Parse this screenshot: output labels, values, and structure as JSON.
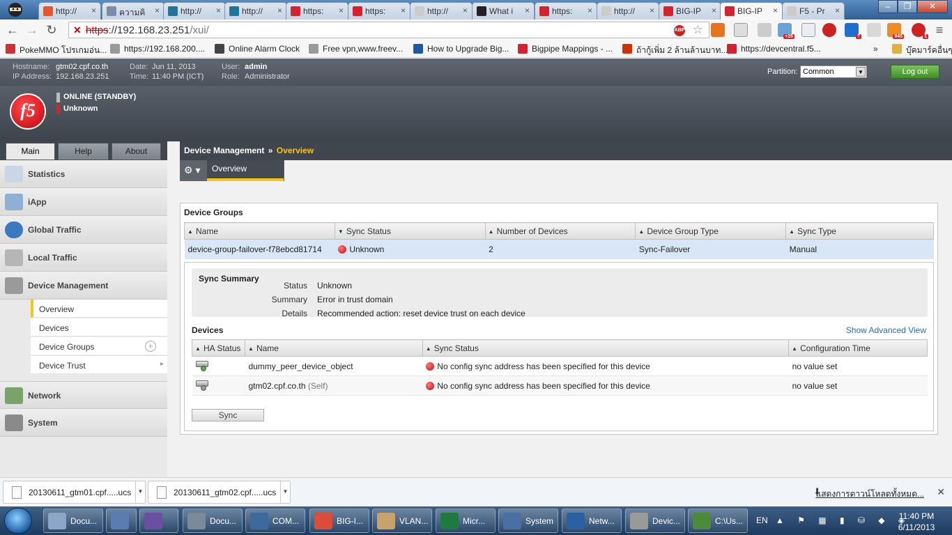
{
  "browser": {
    "tabs": [
      {
        "label": "http://",
        "color": "#e4572e"
      },
      {
        "label": "ความคิ",
        "color": "#7a8ca8"
      },
      {
        "label": "http://",
        "color": "#21759b"
      },
      {
        "label": "http://",
        "color": "#21759b"
      },
      {
        "label": "https:",
        "color": "#d3232e"
      },
      {
        "label": "https:",
        "color": "#d3232e"
      },
      {
        "label": "http://",
        "color": "#cccccc"
      },
      {
        "label": "What i",
        "color": "#222222"
      },
      {
        "label": "https:",
        "color": "#d3232e"
      },
      {
        "label": "http://",
        "color": "#cccccc"
      },
      {
        "label": "BIG-IP",
        "color": "#d3232e"
      },
      {
        "label": "BIG-IP",
        "color": "#d3232e"
      },
      {
        "label": "F5 - Pr",
        "color": "#cccccc"
      }
    ],
    "active_tab_index": 11,
    "address": {
      "scheme": "https",
      "host": "://192.168.23.251",
      "path": "/xui/"
    },
    "bookmarks": [
      {
        "label": "PokeMMO โปรเกมอ่น...",
        "color": "#c33"
      },
      {
        "label": "https://192.168.200....",
        "color": "#999"
      },
      {
        "label": "Online Alarm Clock",
        "color": "#444"
      },
      {
        "label": "Free vpn,www.freev...",
        "color": "#999"
      },
      {
        "label": "How to Upgrade Big...",
        "color": "#1c5aa6"
      },
      {
        "label": "Bigpipe Mappings - ...",
        "color": "#d3232e"
      },
      {
        "label": "ถ้ากู้เพิ่ม 2 ล้านล้านบาท...",
        "color": "#c30"
      },
      {
        "label": "https://devcentral.f5...",
        "color": "#d3232e"
      },
      {
        "label": "»",
        "color": ""
      },
      {
        "label": "บุ๊คมาร์คอื่นๆ",
        "color": "#e0b040"
      }
    ]
  },
  "header": {
    "hostname_key": "Hostname:",
    "hostname": "gtm02.cpf.co.th",
    "ip_key": "IP Address:",
    "ip": "192.168.23.251",
    "date_key": "Date:",
    "date": "Jun 11, 2013",
    "time_key": "Time:",
    "time": "11:40 PM (ICT)",
    "user_key": "User:",
    "user": "admin",
    "role_key": "Role:",
    "role": "Administrator",
    "partition_label": "Partition:",
    "partition_value": "Common",
    "logout_label": "Log out",
    "logo_text": "f5",
    "status_online": "ONLINE (STANDBY)",
    "status_sync": "Unknown",
    "status_online_color": "#bbbbbb",
    "status_sync_color": "#e02020"
  },
  "nav": {
    "tabs": [
      "Main",
      "Help",
      "About"
    ],
    "items": [
      {
        "label": "Statistics",
        "color": "#c8d6e5"
      },
      {
        "label": "iApp",
        "color": "#8fb0d3"
      },
      {
        "label": "Global Traffic",
        "color": "#3a78c2"
      },
      {
        "label": "Local Traffic",
        "color": "#b6b6b6"
      },
      {
        "label": "Device Management",
        "color": "#9a9a9a"
      },
      {
        "label": "Network",
        "color": "#7aa36a"
      },
      {
        "label": "System",
        "color": "#8a8a8a"
      }
    ],
    "sub_items": [
      "Overview",
      "Devices",
      "Device Groups",
      "Device Trust"
    ]
  },
  "main": {
    "breadcrumb_section": "Device Management",
    "breadcrumb_sep": "»",
    "breadcrumb_current": "Overview",
    "tab_label": "Overview",
    "device_groups_title": "Device Groups",
    "dg_columns": [
      "Name",
      "Sync Status",
      "Number of Devices",
      "Device Group Type",
      "Sync Type"
    ],
    "dg_rows": [
      {
        "name": "device-group-failover-f78ebcd81714",
        "sync_status": "Unknown",
        "count": "2",
        "type": "Sync-Failover",
        "sync_type": "Manual"
      }
    ],
    "sync_summary": {
      "title": "Sync Summary",
      "status_key": "Status",
      "status": "Unknown",
      "summary_key": "Summary",
      "summary": "Error in trust domain",
      "details_key": "Details",
      "details": "Recommended action: reset device trust on each device"
    },
    "devices_title": "Devices",
    "advanced_link": "Show Advanced View",
    "dev_columns": [
      "HA Status",
      "Name",
      "Sync Status",
      "Configuration Time"
    ],
    "dev_rows": [
      {
        "name": "dummy_peer_device_object",
        "self": "",
        "sync_status": "No config sync address has been specified for this device",
        "config_time": "no value set",
        "ha_color": "#4fb83b"
      },
      {
        "name": "gtm02.cpf.co.th",
        "self": "(Self)",
        "sync_status": "No config sync address has been specified for this device",
        "config_time": "no value set",
        "ha_color": "#9a9a9a"
      }
    ],
    "sync_button": "Sync"
  },
  "downloads": {
    "items": [
      "20130611_gtm01.cpf.....ucs",
      "20130611_gtm02.cpf.....ucs"
    ],
    "show_all": "แสดงการดาวน์โหลดทั้งหมด..."
  },
  "taskbar": {
    "buttons": [
      {
        "label": "Docu...",
        "color": "#8da6c8"
      },
      {
        "label": "",
        "color": "#5a7cb0"
      },
      {
        "label": "",
        "color": "#6a4fa3"
      },
      {
        "label": "Docu...",
        "color": "#7a8a9a"
      },
      {
        "label": "COM...",
        "color": "#3c6a9c"
      },
      {
        "label": "BIG-I...",
        "color": "#dd4b39"
      },
      {
        "label": "VLAN...",
        "color": "#c9a36b"
      },
      {
        "label": "Micr...",
        "color": "#1f7a3f"
      },
      {
        "label": "System",
        "color": "#4a6fa5"
      },
      {
        "label": "Netw...",
        "color": "#2d5fa3"
      },
      {
        "label": "Devic...",
        "color": "#9a9a9a"
      },
      {
        "label": "C:\\Us...",
        "color": "#4c8a3c"
      }
    ],
    "language": "EN",
    "clock_time": "11:40 PM",
    "clock_date": "6/11/2013"
  }
}
